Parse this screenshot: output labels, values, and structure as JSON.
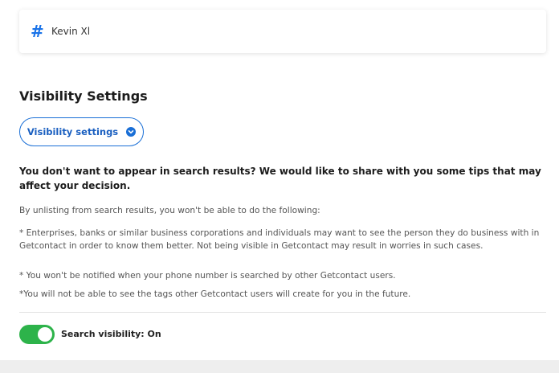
{
  "tag_card": {
    "icon": "hash-icon",
    "name": "Kevin Xl"
  },
  "visibility": {
    "title": "Visibility Settings",
    "button_label": "Visibility settings",
    "button_icon": "chevron-down-circle-icon",
    "tips_heading": "You don't want to appear in search results? We would like to share with you some tips that may affect your decision.",
    "intro": "By unlisting from search results, you won't be able to do the following:",
    "points": [
      "* Enterprises, banks or similar business corporations and individuals may want to see the person they do business with in Getcontact in order to know them better. Not being visible in Getcontact may result in worries in such cases.",
      "* You won't be notified when your phone number is searched by other Getcontact users.",
      "*You will not be able to see the tags other Getcontact users will create for you in the future."
    ],
    "toggle_label": "Search visibility: On",
    "toggle_on": true
  },
  "colors": {
    "accent": "#1a6fd6",
    "toggle_on": "#2db34a"
  }
}
